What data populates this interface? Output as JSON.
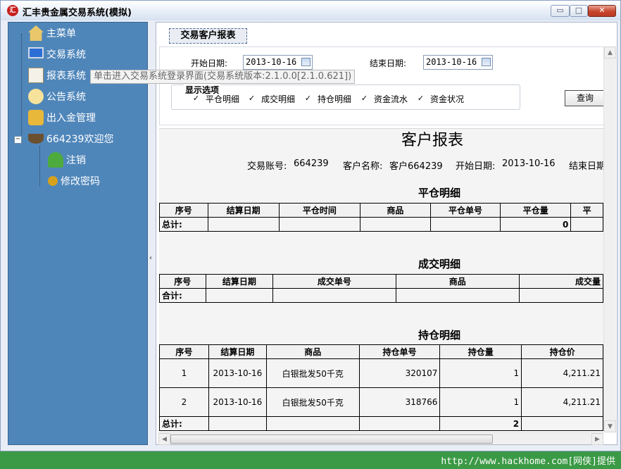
{
  "window": {
    "title": "汇丰贵金属交易系统(模拟)",
    "app_icon_text": "汇",
    "controls": {
      "minimize": "▭",
      "maximize": "□",
      "close": "✕"
    }
  },
  "sidebar": {
    "items": [
      {
        "label": "主菜单",
        "icon": "home-icon"
      },
      {
        "label": "交易系统",
        "icon": "monitor-icon"
      },
      {
        "label": "报表系统",
        "icon": "chart-icon"
      },
      {
        "label": "公告系统",
        "icon": "speech-bubble-icon"
      },
      {
        "label": "出入金管理",
        "icon": "coins-icon"
      },
      {
        "label": "664239欢迎您",
        "icon": "coffee-cup-icon",
        "expanded": true
      },
      {
        "label": "注销",
        "icon": "user-icon"
      },
      {
        "label": "修改密码",
        "icon": "key-icon"
      }
    ],
    "toggle": "−",
    "tooltip": "单击进入交易系统登录界面(交易系统版本:2.1.0.0[2.1.0.621])"
  },
  "splitter": {
    "arrow": "‹"
  },
  "content": {
    "tab_label": "交易客户报表",
    "filters": {
      "start_label": "开始日期:",
      "start_value": "2013-10-16",
      "end_label": "结束日期:",
      "end_value": "2013-10-16",
      "options_title": "显示选项",
      "options": [
        {
          "label": "平仓明细",
          "checked": true
        },
        {
          "label": "成交明细",
          "checked": true
        },
        {
          "label": "持仓明细",
          "checked": true
        },
        {
          "label": "资金流水",
          "checked": true
        },
        {
          "label": "资金状况",
          "checked": true
        }
      ],
      "check_mark": "✓",
      "query_button": "查询"
    },
    "report": {
      "title": "客户报表",
      "account_label": "交易账号:",
      "account_value": "664239",
      "name_label": "客户名称:",
      "name_value": "客户664239",
      "start_label": "开始日期:",
      "start_value": "2013-10-16",
      "end_label": "结束日期",
      "close_section": {
        "title": "平仓明细",
        "headers": [
          "序号",
          "结算日期",
          "平仓时间",
          "商品",
          "平仓单号",
          "平仓量",
          "平"
        ],
        "total_label": "总计:",
        "total_qty": "0"
      },
      "deal_section": {
        "title": "成交明细",
        "headers": [
          "序号",
          "结算日期",
          "成交单号",
          "商品",
          "成交量"
        ],
        "total_label": "合计:"
      },
      "position_section": {
        "title": "持仓明细",
        "headers": [
          "序号",
          "结算日期",
          "商品",
          "持仓单号",
          "持仓量",
          "持仓价"
        ],
        "rows": [
          {
            "no": "1",
            "date": "2013-10-16",
            "product": "白银批发50千克",
            "order": "320107",
            "qty": "1",
            "price": "4,211.21"
          },
          {
            "no": "2",
            "date": "2013-10-16",
            "product": "白银批发50千克",
            "order": "318766",
            "qty": "1",
            "price": "4,211.21"
          }
        ],
        "total_label": "总计:",
        "total_qty": "2"
      }
    },
    "scroll": {
      "up": "▲",
      "down": "▼",
      "left": "◀",
      "right": "▶"
    }
  },
  "footer": {
    "text": "http://www.hackhome.com[网侠]提供"
  }
}
